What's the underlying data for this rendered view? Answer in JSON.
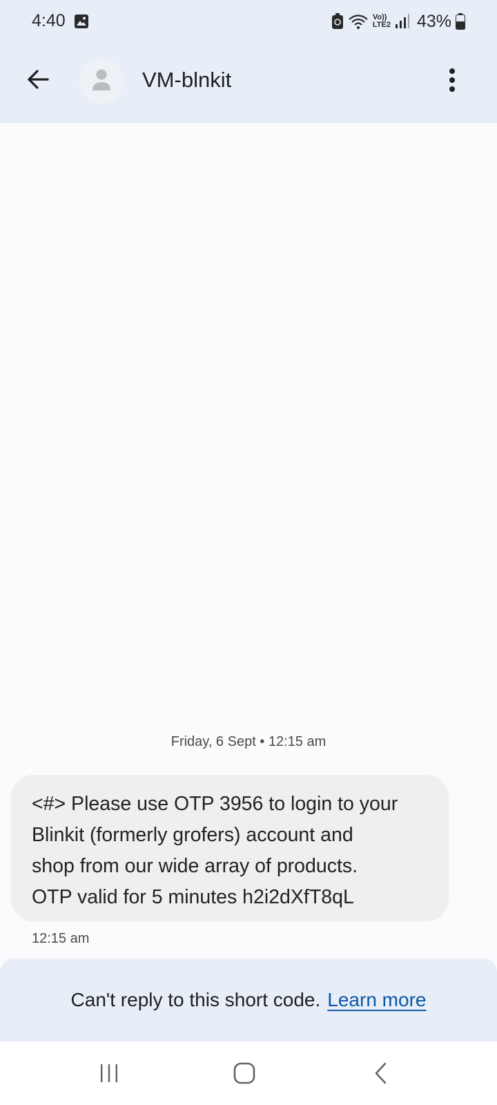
{
  "status_bar": {
    "time": "4:40",
    "battery_percent": "43%",
    "network_label_top": "Vo))",
    "network_label_bottom": "LTE2"
  },
  "app_bar": {
    "contact_name": "VM-blnkit"
  },
  "conversation": {
    "date_separator": "Friday, 6 Sept • 12:15 am",
    "messages": [
      {
        "lines": [
          "<#> Please use OTP 3956 to login to your",
          "Blinkit (formerly grofers) account and",
          "shop from our wide array of products.",
          "OTP valid for 5 minutes h2i2dXfT8qL"
        ],
        "time": "12:15 am"
      }
    ]
  },
  "reply_banner": {
    "text": "Can't reply to this short code.",
    "link": "Learn more"
  },
  "icons": {
    "back": "arrow-left-icon",
    "avatar": "person-icon",
    "more": "more-vert-icon",
    "nav_recents": "recents-icon",
    "nav_home": "home-icon",
    "nav_back": "chevron-left-icon"
  },
  "colors": {
    "header_bg": "#e7eef7",
    "page_bg": "#fbfbfd",
    "bubble_bg": "#efeff1",
    "link": "#0b57a8"
  }
}
